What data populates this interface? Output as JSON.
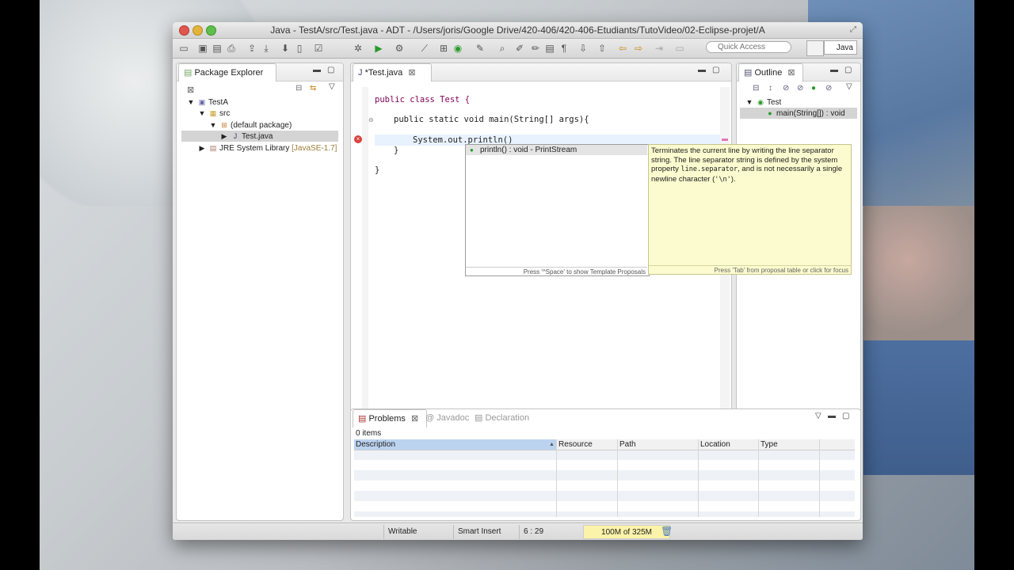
{
  "window": {
    "title": "Java - TestA/src/Test.java - ADT - /Users/joris/Google Drive/420-406/420-406-Etudiants/TutoVideo/02-Eclipse-projet/A"
  },
  "toolbar": {
    "quick_access_placeholder": "Quick Access",
    "perspective_label": "Java"
  },
  "package_explorer": {
    "title": "Package Explorer",
    "tree": [
      {
        "label": "TestA",
        "level": 0
      },
      {
        "label": "src",
        "level": 1
      },
      {
        "label": "(default package)",
        "level": 2
      },
      {
        "label": "Test.java",
        "level": 3,
        "selected": true
      },
      {
        "label": "JRE System Library",
        "extra": "[JavaSE-1.7]",
        "level": 1
      }
    ]
  },
  "editor": {
    "tab_label": "*Test.java",
    "lines": [
      "public class Test {",
      "public static void main(String[] args){",
      "System.out.println()",
      "}",
      "}"
    ]
  },
  "completion": {
    "item": "println() : void - PrintStream",
    "footer": "Press '^Space' to show Template Proposals",
    "doc_part1": "Terminates the current line by writing the line separator string. The line separator string is defined by the system property ",
    "doc_code1": "line.separator",
    "doc_part2": ", and is not necessarily a single newline character (",
    "doc_code2": "'\\n'",
    "doc_part3": ").",
    "doc_footer": "Press 'Tab' from proposal table or click for focus"
  },
  "outline": {
    "title": "Outline",
    "class_name": "Test",
    "method": "main(String[]) : void"
  },
  "problems": {
    "tabs": [
      "Problems",
      "Javadoc",
      "Declaration"
    ],
    "count": "0 items",
    "columns": [
      "Description",
      "Resource",
      "Path",
      "Location",
      "Type"
    ]
  },
  "status": {
    "writable": "Writable",
    "insert_mode": "Smart Insert",
    "position": "6 : 29",
    "memory": "100M of 325M"
  }
}
